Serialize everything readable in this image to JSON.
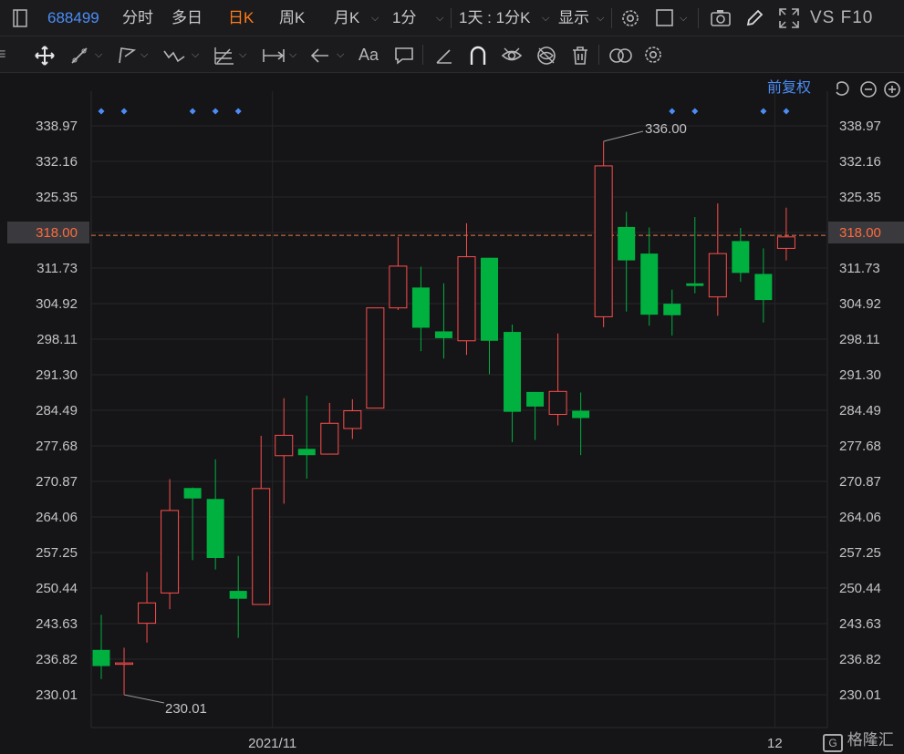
{
  "toolbar": {
    "symbol": "688499",
    "periods": [
      "分时",
      "多日",
      "日K",
      "周K",
      "月K",
      "1分"
    ],
    "active_period": "日K",
    "range_select": "1天 : 1分K",
    "display_label": "显示",
    "vs_label": "VS F10",
    "drawing_tools": [
      "move-icon",
      "line-icon",
      "polyline-icon",
      "wave-icon",
      "fibonacci-icon",
      "measure-icon",
      "arrow-icon",
      "text-icon",
      "comment-icon",
      "ruler-icon",
      "magnet-icon",
      "eye-icon",
      "hide-icon",
      "trash-icon",
      "compare-icon",
      "settings-icon"
    ]
  },
  "adjust_label": "前复权",
  "colors": {
    "up": "#ff4d4d",
    "down": "#00b140",
    "marker": "#4b8df5",
    "price_line": "#e87a4a"
  },
  "chart_data": {
    "type": "candlestick",
    "y_ticks": [
      338.97,
      332.16,
      325.35,
      318.54,
      311.73,
      304.92,
      298.11,
      291.3,
      284.49,
      277.68,
      270.87,
      264.06,
      257.25,
      250.44,
      243.63,
      236.82,
      230.01
    ],
    "y_tick_labels": [
      "338.97",
      "332.16",
      "325.35",
      "318.00",
      "311.73",
      "304.92",
      "298.11",
      "291.30",
      "284.49",
      "277.68",
      "270.87",
      "264.06",
      "257.25",
      "250.44",
      "243.63",
      "236.82",
      "230.01"
    ],
    "current_price": 318.0,
    "current_price_label": "318.00",
    "x_labels": [
      {
        "label": "2021/11",
        "index": 7.5
      },
      {
        "label": "12",
        "index": 29.5
      }
    ],
    "high_annotation": {
      "label": "336.00",
      "index": 22
    },
    "low_annotation": {
      "label": "230.01",
      "index": 1
    },
    "event_markers": [
      0,
      1,
      4,
      5,
      6,
      25,
      26,
      29,
      30
    ],
    "candles": [
      {
        "o": 238.6,
        "h": 245.3,
        "l": 233.0,
        "c": 235.5
      },
      {
        "o": 235.9,
        "h": 239.0,
        "l": 230.0,
        "c": 236.1
      },
      {
        "o": 243.7,
        "h": 253.5,
        "l": 240.0,
        "c": 247.6
      },
      {
        "o": 249.5,
        "h": 271.3,
        "l": 246.4,
        "c": 265.3
      },
      {
        "o": 269.6,
        "h": 269.7,
        "l": 255.8,
        "c": 267.6
      },
      {
        "o": 267.5,
        "h": 275.1,
        "l": 254.0,
        "c": 256.2
      },
      {
        "o": 249.9,
        "h": 256.6,
        "l": 240.9,
        "c": 248.4
      },
      {
        "o": 247.3,
        "h": 279.6,
        "l": 247.3,
        "c": 269.5
      },
      {
        "o": 275.8,
        "h": 286.8,
        "l": 266.6,
        "c": 279.7
      },
      {
        "o": 277.1,
        "h": 287.3,
        "l": 271.4,
        "c": 275.9
      },
      {
        "o": 276.1,
        "h": 285.9,
        "l": 276.1,
        "c": 282.0
      },
      {
        "o": 281.0,
        "h": 286.6,
        "l": 279.0,
        "c": 284.4
      },
      {
        "o": 284.9,
        "h": 298.2,
        "l": 284.9,
        "c": 304.1
      },
      {
        "o": 304.1,
        "h": 317.7,
        "l": 303.7,
        "c": 312.1
      },
      {
        "o": 308.0,
        "h": 312.0,
        "l": 295.8,
        "c": 300.3
      },
      {
        "o": 299.6,
        "h": 308.8,
        "l": 294.4,
        "c": 298.3
      },
      {
        "o": 297.8,
        "h": 320.3,
        "l": 295.1,
        "c": 313.9
      },
      {
        "o": 313.7,
        "h": 313.7,
        "l": 291.4,
        "c": 297.8
      },
      {
        "o": 299.5,
        "h": 300.9,
        "l": 278.4,
        "c": 284.2
      },
      {
        "o": 288.0,
        "h": 288.0,
        "l": 278.8,
        "c": 285.2
      },
      {
        "o": 283.7,
        "h": 299.2,
        "l": 281.6,
        "c": 288.1
      },
      {
        "o": 284.4,
        "h": 287.9,
        "l": 275.9,
        "c": 283.0
      },
      {
        "o": 302.4,
        "h": 336.0,
        "l": 300.4,
        "c": 331.3
      },
      {
        "o": 319.6,
        "h": 322.5,
        "l": 303.4,
        "c": 313.2
      },
      {
        "o": 314.5,
        "h": 319.5,
        "l": 300.7,
        "c": 302.8
      },
      {
        "o": 304.9,
        "h": 307.6,
        "l": 298.8,
        "c": 302.7
      },
      {
        "o": 308.8,
        "h": 321.5,
        "l": 306.9,
        "c": 308.3
      },
      {
        "o": 306.2,
        "h": 324.1,
        "l": 302.6,
        "c": 314.5
      },
      {
        "o": 316.9,
        "h": 319.4,
        "l": 309.1,
        "c": 310.8
      },
      {
        "o": 310.6,
        "h": 315.5,
        "l": 301.3,
        "c": 305.6
      },
      {
        "o": 315.5,
        "h": 323.3,
        "l": 313.2,
        "c": 317.7
      }
    ]
  },
  "watermark": "格隆汇"
}
